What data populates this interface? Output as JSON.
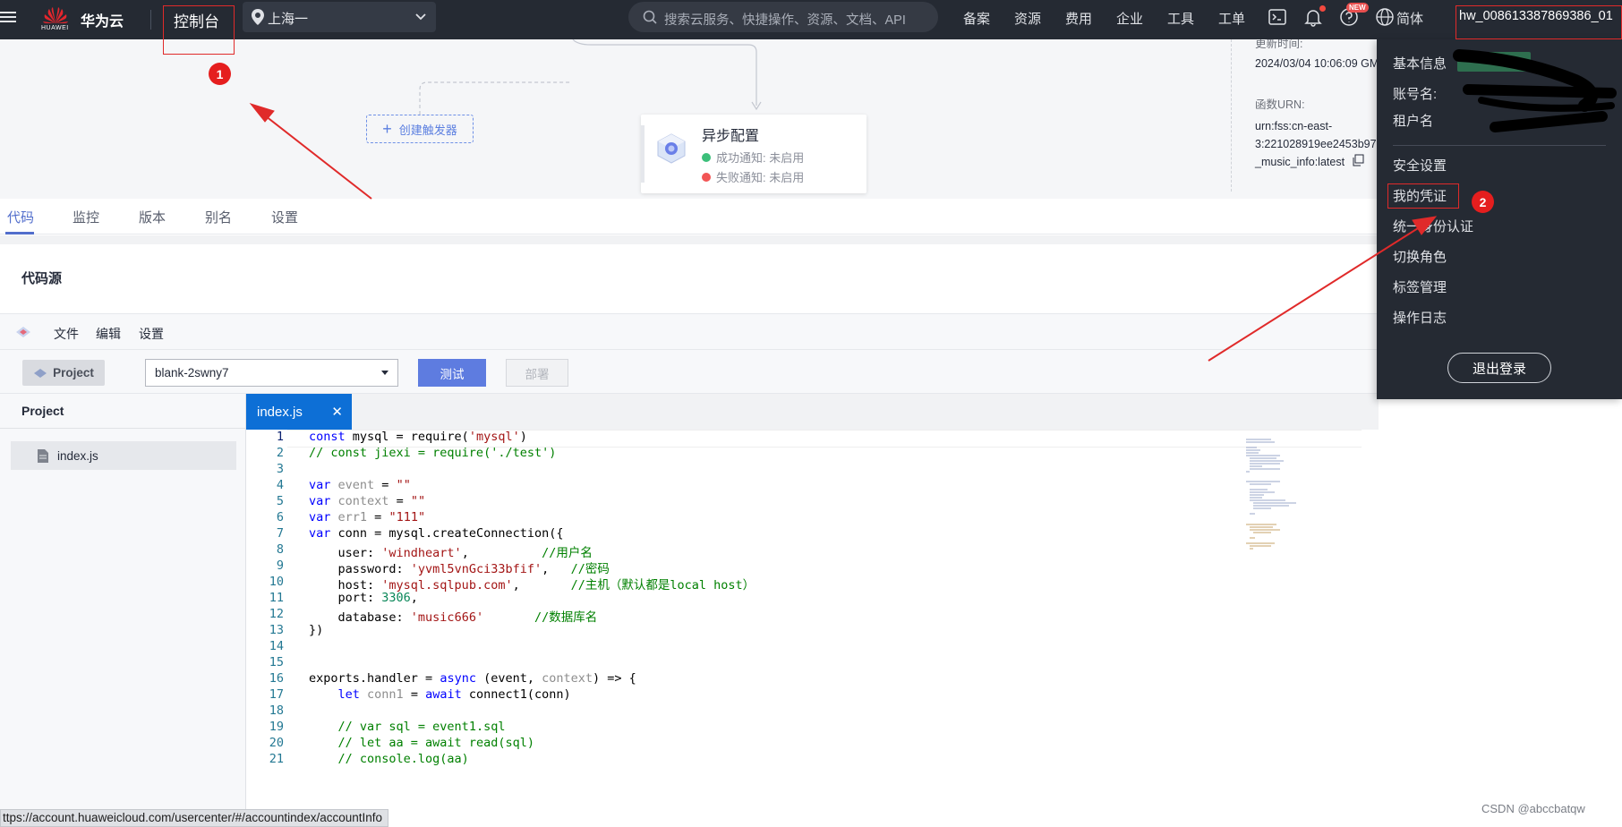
{
  "topbar": {
    "logo_text": "HUAWEI",
    "brand": "华为云",
    "console": "控制台",
    "region": "上海一",
    "search_placeholder": "搜索云服务、快捷操作、资源、文档、API",
    "nav": [
      "备案",
      "资源",
      "费用",
      "企业",
      "工具",
      "工单"
    ],
    "new_badge": "NEW",
    "language": "简体",
    "account": "hw_008613387869386_01"
  },
  "workflow": {
    "create_trigger": "创建触发器",
    "async_title": "异步配置",
    "success_notify": "成功通知: 未启用",
    "failure_notify": "失败通知: 未启用",
    "success_color": "#3cbf7a",
    "failure_color": "#f25555",
    "updated_label": "更新时间:",
    "updated_value": "2024/03/04 10:06:09 GM",
    "urn_label": "函数URN:",
    "urn_line1": "urn:fss:cn-east-",
    "urn_line2": "3:221028919ee2453b97",
    "urn_line3": "_music_info:latest"
  },
  "tabs": [
    "代码",
    "监控",
    "版本",
    "别名",
    "设置"
  ],
  "code_source": "代码源",
  "ide": {
    "menu": [
      "文件",
      "编辑",
      "设置"
    ],
    "project_button": "Project",
    "function_select": "blank-2swny7",
    "test_button": "测试",
    "deploy_button": "部署",
    "project_header": "Project",
    "file_name": "index.js",
    "editor_tab": "index.js",
    "line_numbers": [
      "1",
      "2",
      "3",
      "4",
      "5",
      "6",
      "7",
      "8",
      "9",
      "10",
      "11",
      "12",
      "13",
      "14",
      "15",
      "16",
      "17",
      "18",
      "19",
      "20",
      "21"
    ]
  },
  "dropdown": {
    "basic_info": "基本信息",
    "account_name": "账号名:",
    "tenant_name": "租户名",
    "security": "安全设置",
    "credentials": "我的凭证",
    "identity": "统一身份认证",
    "switch_role": "切换角色",
    "tags": "标签管理",
    "logs": "操作日志",
    "logout": "退出登录"
  },
  "annotations": {
    "one": "1",
    "two": "2",
    "color": "#e02a2a"
  },
  "status_url": "ttps://account.huaweicloud.com/usercenter/#/accountindex/accountInfo",
  "watermark": "CSDN @abccbatqw"
}
